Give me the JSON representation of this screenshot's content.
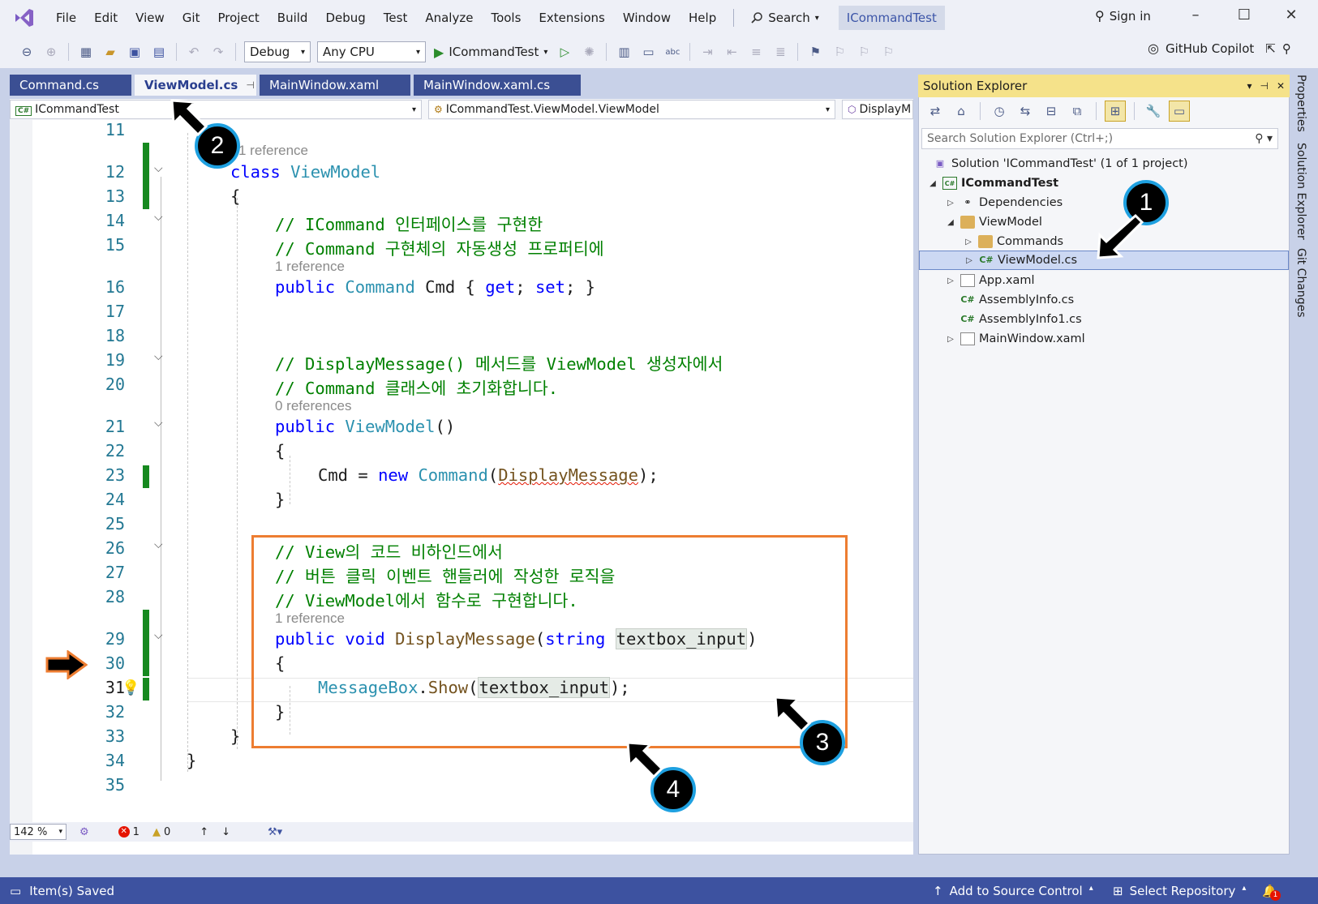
{
  "menu": {
    "items": [
      "File",
      "Edit",
      "View",
      "Git",
      "Project",
      "Build",
      "Debug",
      "Test",
      "Analyze",
      "Tools",
      "Extensions",
      "Window",
      "Help"
    ],
    "search_label": "Search",
    "solution_badge": "ICommandTest",
    "sign_in": "Sign in"
  },
  "toolbar": {
    "config": "Debug",
    "platform": "Any CPU",
    "run_target": "ICommandTest",
    "copilot": "GitHub Copilot"
  },
  "tabs": [
    {
      "label": "Command.cs",
      "active": false
    },
    {
      "label": "ViewModel.cs",
      "active": true
    },
    {
      "label": "MainWindow.xaml",
      "active": false
    },
    {
      "label": "MainWindow.xaml.cs",
      "active": false
    }
  ],
  "navbar": {
    "project": "ICommandTest",
    "type": "ICommandTest.ViewModel.ViewModel",
    "member": "DisplayM"
  },
  "code": {
    "lines": [
      {
        "n": "11"
      },
      {
        "n": "12",
        "ref": "1 reference"
      },
      {
        "n": "13"
      },
      {
        "n": "14"
      },
      {
        "n": "15"
      },
      {
        "n": "16",
        "ref": "1 reference"
      },
      {
        "n": "17"
      },
      {
        "n": "18"
      },
      {
        "n": "19"
      },
      {
        "n": "20"
      },
      {
        "n": "21",
        "ref": "0 references"
      },
      {
        "n": "22"
      },
      {
        "n": "23"
      },
      {
        "n": "24"
      },
      {
        "n": "25"
      },
      {
        "n": "26"
      },
      {
        "n": "27"
      },
      {
        "n": "28"
      },
      {
        "n": "29",
        "ref": "1 reference"
      },
      {
        "n": "30"
      },
      {
        "n": "31"
      },
      {
        "n": "32"
      },
      {
        "n": "33"
      },
      {
        "n": "34"
      },
      {
        "n": "35"
      }
    ],
    "text": {
      "l12_kw": "class",
      "l12_name": "ViewModel",
      "l13": "{",
      "l14": "// ICommand 인터페이스를 구현한",
      "l15": "// Command 구현체의 자동생성 프로퍼티에",
      "l16_kw1": "public",
      "l16_type": "Command",
      "l16_name": "Cmd",
      "l16_b1": "{",
      "l16_get": "get",
      "l16_set": "set",
      "l16_b2": "}",
      "l19": "// DisplayMessage() 메서드를 ViewModel 생성자에서",
      "l20": "// Command 클래스에 초기화합니다.",
      "l21_kw": "public",
      "l21_ctor": "ViewModel",
      "l21_paren": "()",
      "l22": "{",
      "l23_cmd": "Cmd",
      "l23_eq": "=",
      "l23_new": "new",
      "l23_type": "Command",
      "l23_arg": "DisplayMessage",
      "l24": "}",
      "l26": "// View의 코드 비하인드에서",
      "l27": "// 버튼 클릭 이벤트 핸들러에 작성한 로직을",
      "l28": "// ViewModel에서 함수로 구현합니다.",
      "l29_pub": "public",
      "l29_void": "void",
      "l29_meth": "DisplayMessage",
      "l29_str": "string",
      "l29_param": "textbox_input",
      "l30": "{",
      "l31_type": "MessageBox",
      "l31_meth": "Show",
      "l31_arg": "textbox_input",
      "l32": "}",
      "l33": "}",
      "l34": "}"
    }
  },
  "editor_status": {
    "zoom": "142 %",
    "errors": "1",
    "warnings": "0"
  },
  "solution_explorer": {
    "title": "Solution Explorer",
    "search_placeholder": "Search Solution Explorer (Ctrl+;)",
    "tree": [
      {
        "label": "Solution 'ICommandTest' (1 of 1 project)"
      },
      {
        "label": "ICommandTest"
      },
      {
        "label": "Dependencies"
      },
      {
        "label": "ViewModel"
      },
      {
        "label": "Commands"
      },
      {
        "label": "ViewModel.cs"
      },
      {
        "label": "App.xaml"
      },
      {
        "label": "AssemblyInfo.cs"
      },
      {
        "label": "AssemblyInfo1.cs"
      },
      {
        "label": "MainWindow.xaml"
      }
    ]
  },
  "side_tabs": [
    "Properties",
    "Solution Explorer",
    "Git Changes"
  ],
  "statusbar": {
    "saved": "Item(s) Saved",
    "source_control": "Add to Source Control",
    "repo": "Select Repository",
    "notif_count": "1"
  },
  "annotations": {
    "badges": [
      "1",
      "2",
      "3",
      "4"
    ]
  },
  "colors": {
    "accent": "#3d52a0",
    "highlight_box": "#ed7d31",
    "badge_ring": "#1ea0e0",
    "change_bar": "#16891f"
  }
}
